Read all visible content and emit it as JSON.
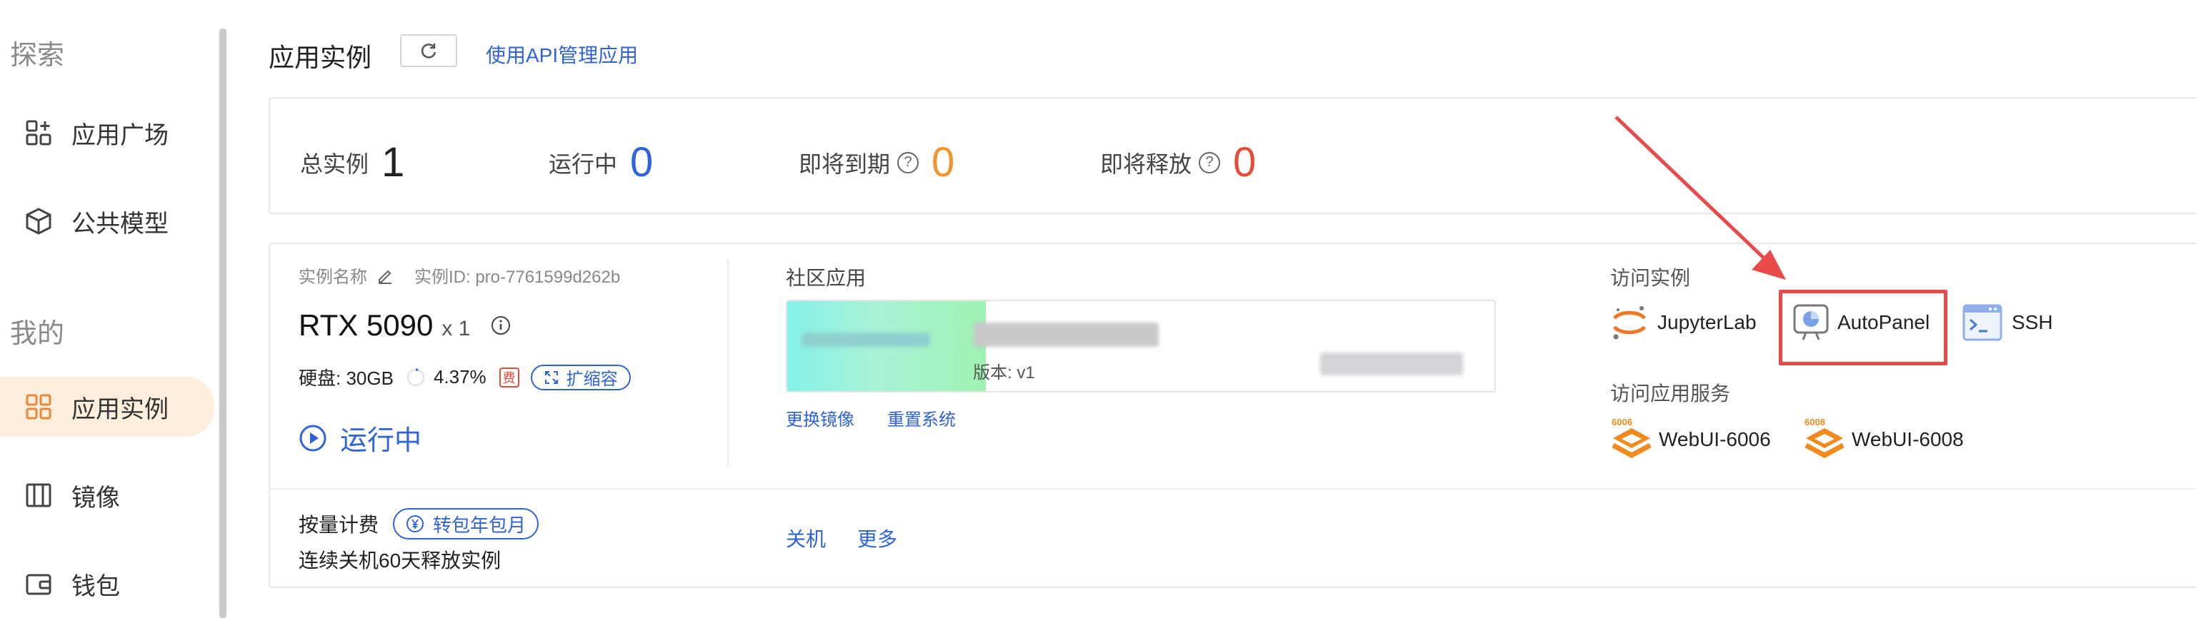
{
  "sidebar": {
    "section_explore": "探索",
    "section_mine": "我的",
    "items": [
      {
        "label": "应用广场",
        "icon": "apps-add-icon"
      },
      {
        "label": "公共模型",
        "icon": "cube-icon"
      },
      {
        "label": "应用实例",
        "icon": "grid-icon",
        "active": true
      },
      {
        "label": "镜像",
        "icon": "mirror-icon"
      },
      {
        "label": "钱包",
        "icon": "wallet-icon"
      }
    ]
  },
  "header": {
    "title": "应用实例",
    "api_link": "使用API管理应用"
  },
  "stats": {
    "total_label": "总实例",
    "total_value": "1",
    "running_label": "运行中",
    "running_value": "0",
    "expiring_label": "即将到期",
    "expiring_value": "0",
    "releasing_label": "即将释放",
    "releasing_value": "0",
    "colors": {
      "total": "#222222",
      "running": "#2f63d8",
      "expiring": "#f0952a",
      "releasing": "#e64b3c"
    }
  },
  "instance": {
    "name_label": "实例名称",
    "id_label": "实例ID: pro-7761599d262b",
    "gpu": "RTX 5090",
    "gpu_count": "x 1",
    "disk": "硬盘: 30GB",
    "disk_usage": "4.37%",
    "fee_badge": "费",
    "expand_label": "扩缩容",
    "status": "运行中",
    "billing": "按量计费",
    "switch_plan": "转包年包月",
    "release_note": "连续关机60天释放实例",
    "actions": {
      "shutdown": "关机",
      "more": "更多"
    }
  },
  "community": {
    "title": "社区应用",
    "version": "版本: v1",
    "change_image": "更换镜像",
    "reset_system": "重置系统"
  },
  "access": {
    "title": "访问实例",
    "items": [
      {
        "label": "JupyterLab",
        "icon": "jupyter-icon"
      },
      {
        "label": "AutoPanel",
        "icon": "autopanel-icon"
      },
      {
        "label": "SSH",
        "icon": "terminal-icon"
      }
    ],
    "services_title": "访问应用服务",
    "services": [
      {
        "label": "WebUI-6006",
        "badge": "6006"
      },
      {
        "label": "WebUI-6008",
        "badge": "6008"
      }
    ]
  },
  "annotation": {
    "highlight_color": "#e84a4a"
  }
}
